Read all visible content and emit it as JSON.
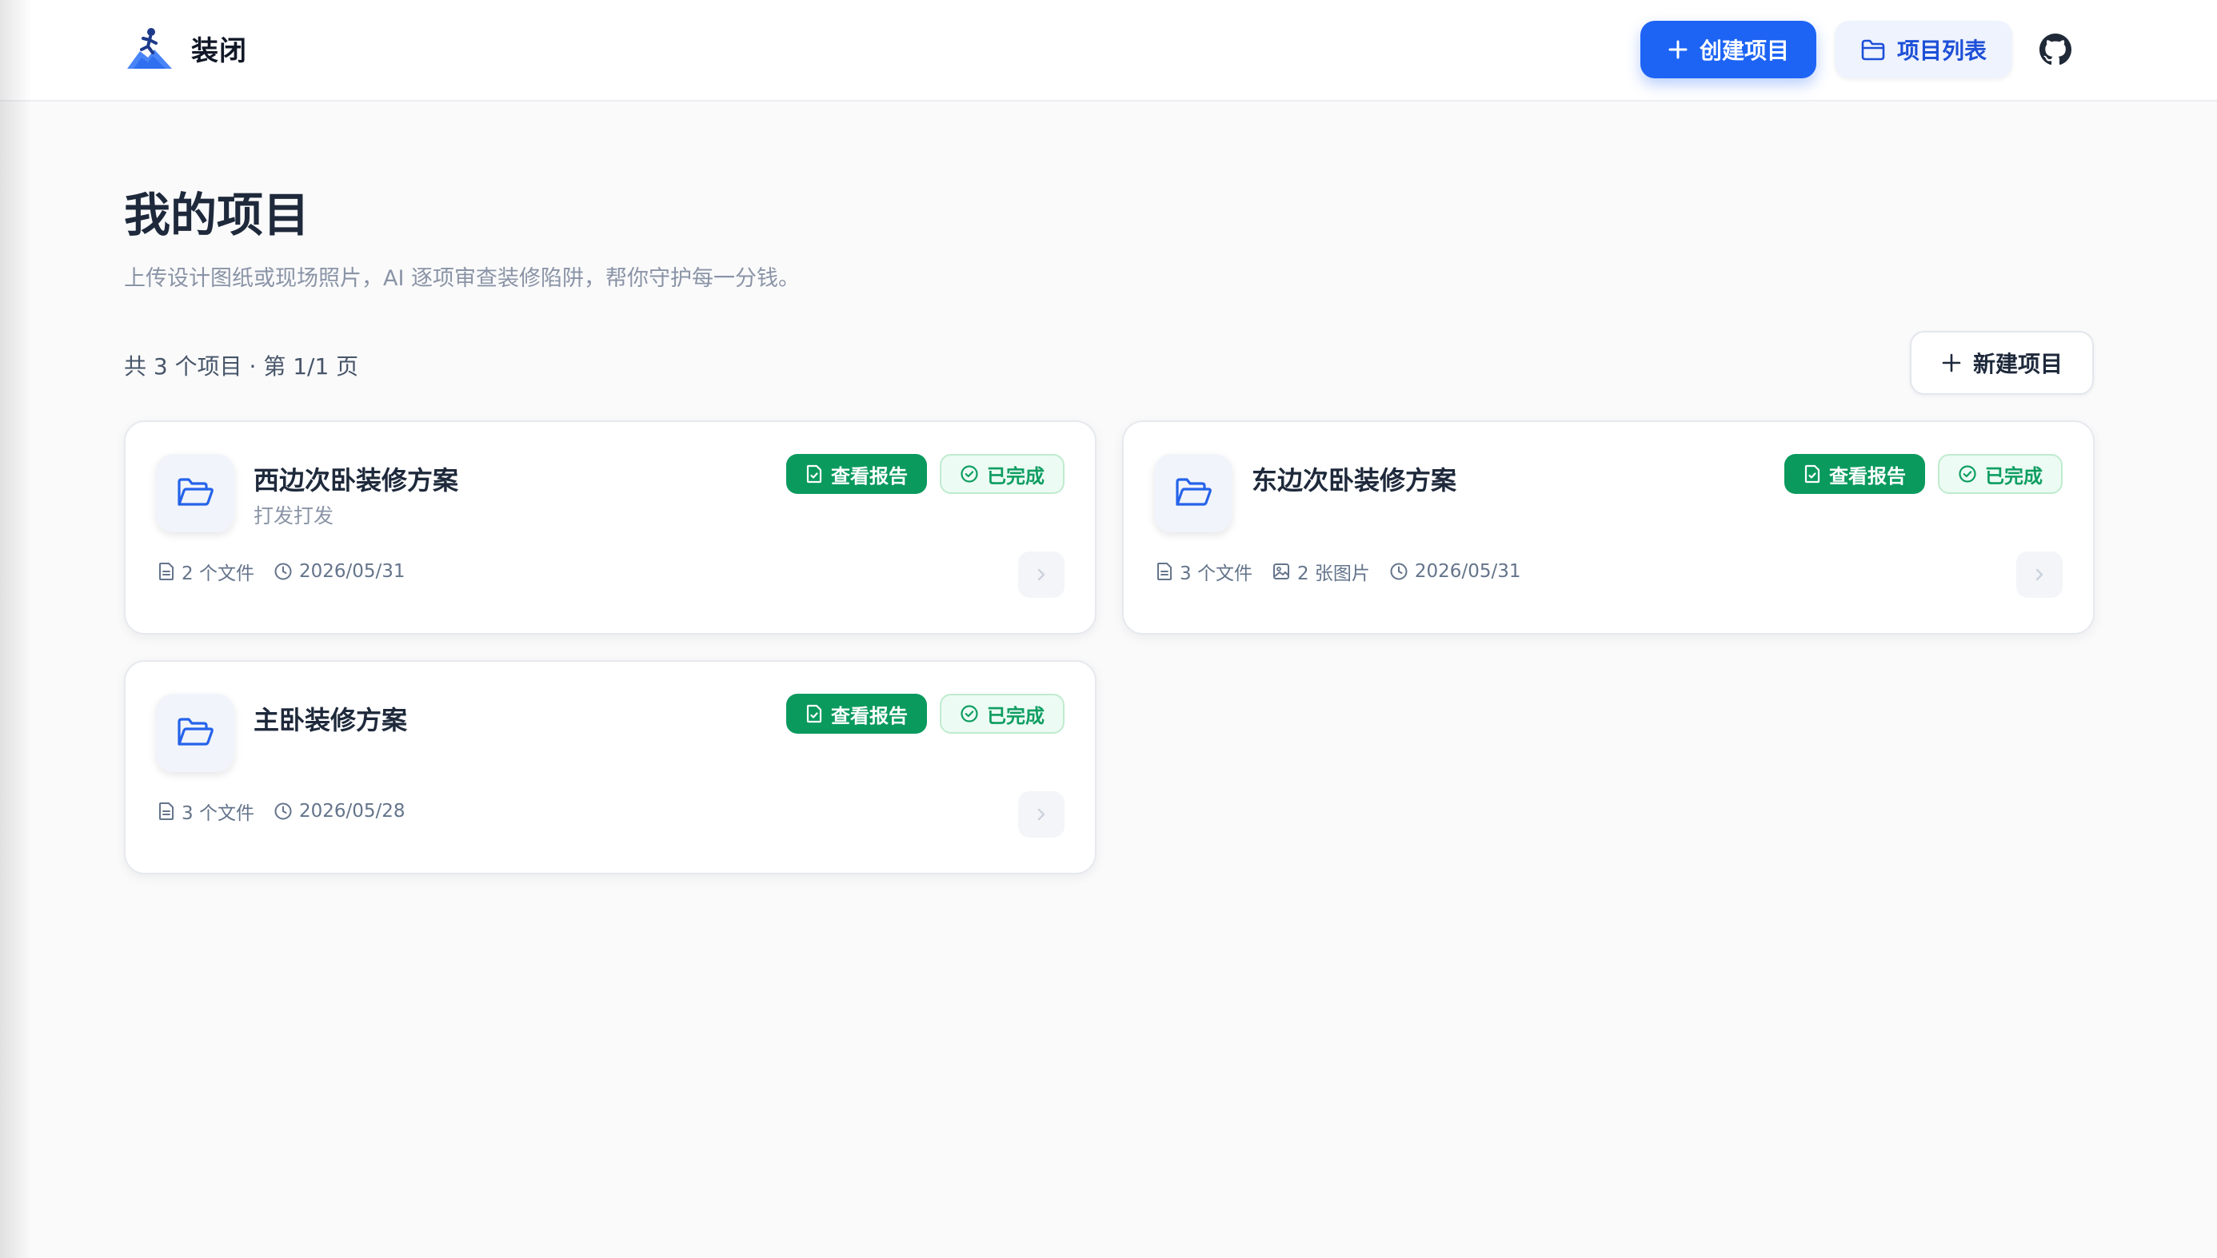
{
  "header": {
    "brand_name": "装闭",
    "create_button": "创建项目",
    "list_button": "项目列表"
  },
  "main": {
    "title": "我的项目",
    "subtitle": "上传设计图纸或现场照片，AI 逐项审查装修陷阱，帮你守护每一分钱。",
    "count_text": "共 3 个项目 · 第 1/1 页",
    "new_button": "新建项目"
  },
  "projects": [
    {
      "title": "西边次卧装修方案",
      "description": "打发打发",
      "files": "2 个文件",
      "images": "",
      "date": "2026/05/31",
      "report_label": "查看报告",
      "status_label": "已完成"
    },
    {
      "title": "东边次卧装修方案",
      "description": "",
      "files": "3 个文件",
      "images": "2 张图片",
      "date": "2026/05/31",
      "report_label": "查看报告",
      "status_label": "已完成"
    },
    {
      "title": "主卧装修方案",
      "description": "",
      "files": "3 个文件",
      "images": "",
      "date": "2026/05/28",
      "report_label": "查看报告",
      "status_label": "已完成"
    }
  ],
  "colors": {
    "primary": "#1d64f5",
    "success": "#0a9a5e",
    "success_light": "#ecfbf3",
    "text_dark": "#1e293b",
    "text_muted": "#8a94a6"
  },
  "icons": {
    "logo": "climbing-person-icon",
    "create": "plus-icon",
    "list": "folder-icon",
    "github": "github-icon",
    "card_folder": "folder-open-icon",
    "report": "file-check-icon",
    "done": "check-circle-icon",
    "files": "file-icon",
    "images": "image-icon",
    "date": "clock-icon",
    "arrow": "chevron-right-icon"
  }
}
